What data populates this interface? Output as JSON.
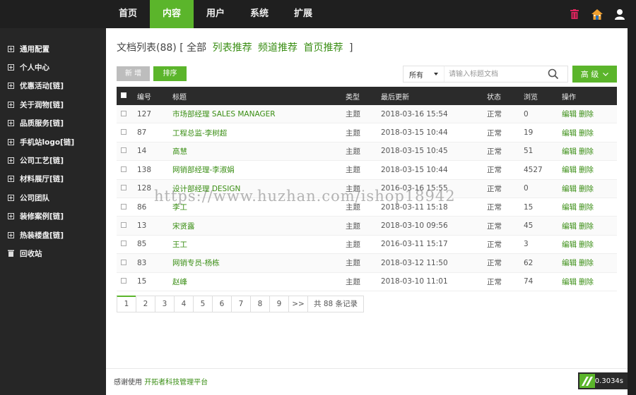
{
  "topnav": {
    "items": [
      {
        "label": "首页"
      },
      {
        "label": "内容",
        "active": true
      },
      {
        "label": "用户"
      },
      {
        "label": "系统"
      },
      {
        "label": "扩展"
      }
    ],
    "icons": [
      "trash-icon",
      "home-icon",
      "user-icon"
    ]
  },
  "sidebar": {
    "items": [
      {
        "label": "通用配置"
      },
      {
        "label": "个人中心"
      },
      {
        "label": "优惠活动[链]"
      },
      {
        "label": "关于润物[链]"
      },
      {
        "label": "品质服务[链]"
      },
      {
        "label": "手机站logo[链]"
      },
      {
        "label": "公司工艺[链]"
      },
      {
        "label": "材料展厅[链]"
      },
      {
        "label": "公司团队"
      },
      {
        "label": "装修案例[链]"
      },
      {
        "label": "热装楼盘[链]"
      }
    ],
    "recycle": "回收站"
  },
  "header": {
    "title": "文档列表(88)",
    "bracket_open": "[",
    "bracket_close": "]",
    "filters": [
      "全部",
      "列表推荐",
      "频道推荐",
      "首页推荐"
    ]
  },
  "toolbar": {
    "new_label": "新 增",
    "sort_label": "排序",
    "search_scope": "所有",
    "search_placeholder": "请输入标题文档",
    "advanced_label": "高 级"
  },
  "table": {
    "columns": [
      "编号",
      "标题",
      "类型",
      "最后更新",
      "状态",
      "浏览",
      "操作"
    ],
    "rows": [
      {
        "id": "127",
        "title": "市场部经理 SALES MANAGER",
        "type": "主题",
        "updated": "2018-03-16 15:54",
        "status": "正常",
        "views": "0"
      },
      {
        "id": "87",
        "title": "工程总监-李树超",
        "type": "主题",
        "updated": "2018-03-15 10:44",
        "status": "正常",
        "views": "19"
      },
      {
        "id": "14",
        "title": "高慧",
        "type": "主题",
        "updated": "2018-03-15 10:45",
        "status": "正常",
        "views": "51"
      },
      {
        "id": "138",
        "title": "网销部经理-李淑娟",
        "type": "主题",
        "updated": "2018-03-15 10:44",
        "status": "正常",
        "views": "4527"
      },
      {
        "id": "128",
        "title": "设计部经理 DESIGN",
        "type": "主题",
        "updated": "2016-03-16 15:55",
        "status": "正常",
        "views": "0"
      },
      {
        "id": "86",
        "title": "李工",
        "type": "主题",
        "updated": "2018-03-11 15:18",
        "status": "正常",
        "views": "15"
      },
      {
        "id": "13",
        "title": "宋贤露",
        "type": "主题",
        "updated": "2018-03-10 09:56",
        "status": "正常",
        "views": "45"
      },
      {
        "id": "85",
        "title": "王工",
        "type": "主题",
        "updated": "2016-03-11 15:17",
        "status": "正常",
        "views": "3"
      },
      {
        "id": "83",
        "title": "网销专员-杨栋",
        "type": "主题",
        "updated": "2018-03-12 11:50",
        "status": "正常",
        "views": "62"
      },
      {
        "id": "15",
        "title": "赵峰",
        "type": "主题",
        "updated": "2018-03-10 11:01",
        "status": "正常",
        "views": "74"
      }
    ],
    "edit_label": "编辑",
    "delete_label": "删除"
  },
  "pagination": {
    "pages": [
      "1",
      "2",
      "3",
      "4",
      "5",
      "6",
      "7",
      "8",
      "9"
    ],
    "current": "1",
    "next_label": ">>",
    "total_label": "共 88 条记录"
  },
  "footer": {
    "prefix": "感谢使用",
    "product": "开拓者科技管理平台"
  },
  "timer": "0.3034s",
  "watermark": "https://www.huzhan.com/ishop18942",
  "colors": {
    "accent": "#5bb52b",
    "link": "#3a8e14",
    "dark": "#1f1f1f"
  }
}
